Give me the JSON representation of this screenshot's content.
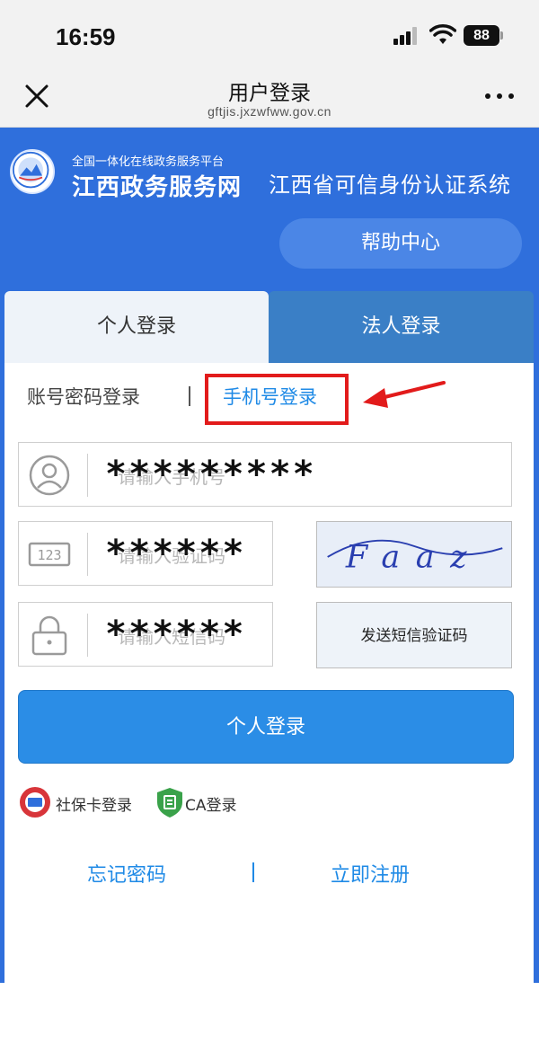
{
  "status": {
    "time": "16:59",
    "battery": "88"
  },
  "nav": {
    "title": "用户登录",
    "url": "gftjis.jxzwfww.gov.cn"
  },
  "header": {
    "platform_sub": "全国一体化在线政务服务平台",
    "platform_name": "江西政务服务网",
    "system_name": "江西省可信身份认证系统",
    "help_label": "帮助中心"
  },
  "tabs": [
    {
      "label": "个人登录",
      "active": true
    },
    {
      "label": "法人登录",
      "active": false
    }
  ],
  "modes": {
    "account_label": "账号密码登录",
    "phone_label": "手机号登录"
  },
  "fields": {
    "phone": {
      "placeholder": "请输入手机号",
      "value": "*********"
    },
    "captcha": {
      "placeholder": "请输入验证码",
      "value": "******",
      "image_text": "Faaz"
    },
    "sms": {
      "placeholder": "请输入短信码",
      "value": "******",
      "button_label": "发送短信验证码"
    }
  },
  "login_button": "个人登录",
  "alt_login": {
    "shebao_label": "社保卡登录",
    "ca_label": "CA登录"
  },
  "links": {
    "forget": "忘记密码",
    "register": "立即注册"
  },
  "colors": {
    "brand_blue": "#2f6fdc",
    "link_blue": "#1f8ae6",
    "highlight_red": "#e21b1b"
  }
}
